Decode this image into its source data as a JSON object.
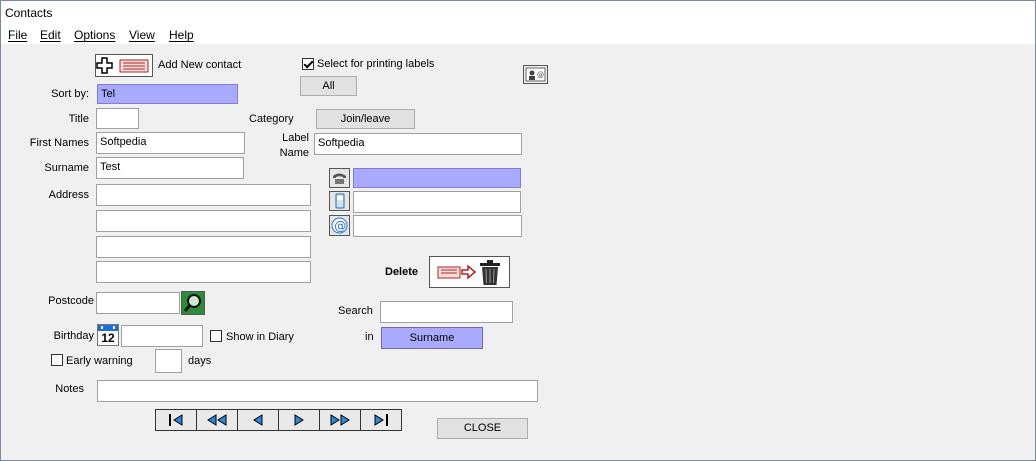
{
  "window": {
    "title": "Contacts"
  },
  "menu": [
    {
      "label": "File"
    },
    {
      "label": "Edit"
    },
    {
      "label": "Options"
    },
    {
      "label": "View"
    },
    {
      "label": "Help"
    }
  ],
  "add_contact": {
    "label": "Add New contact"
  },
  "printing": {
    "checkbox_label": "Select for printing labels",
    "checked": true,
    "all_button": "All"
  },
  "sort": {
    "label": "Sort by:",
    "value": "Tel"
  },
  "title_field": {
    "label": "Title",
    "value": ""
  },
  "category": {
    "label": "Category",
    "button": "Join/leave"
  },
  "first_names": {
    "label": "First Names",
    "value": "Softpedia"
  },
  "label_name": {
    "label_line1": "Label",
    "label_line2": "Name",
    "value": "Softpedia"
  },
  "surname": {
    "label": "Surname",
    "value": "Test"
  },
  "address": {
    "label": "Address",
    "lines": [
      "",
      "",
      "",
      ""
    ]
  },
  "contacts": {
    "phone": "",
    "mobile": "",
    "email": ""
  },
  "delete": {
    "label": "Delete"
  },
  "postcode": {
    "label": "Postcode",
    "value": ""
  },
  "search": {
    "label": "Search",
    "value": "",
    "in_label": "in",
    "in_value": "Surname"
  },
  "birthday": {
    "label": "Birthday",
    "value": "",
    "calendar_day": "12",
    "show_in_diary_label": "Show in Diary",
    "show_in_diary": false
  },
  "early_warning": {
    "label": "Early warning",
    "checked": false,
    "days_value": "",
    "days_label": "days"
  },
  "notes": {
    "label": "Notes",
    "value": ""
  },
  "close_button": "CLOSE",
  "colors": {
    "selection": "#a9aaff",
    "background": "#f0f0f0",
    "accent_red": "#b22222",
    "accent_blue": "#1e6fd9"
  }
}
